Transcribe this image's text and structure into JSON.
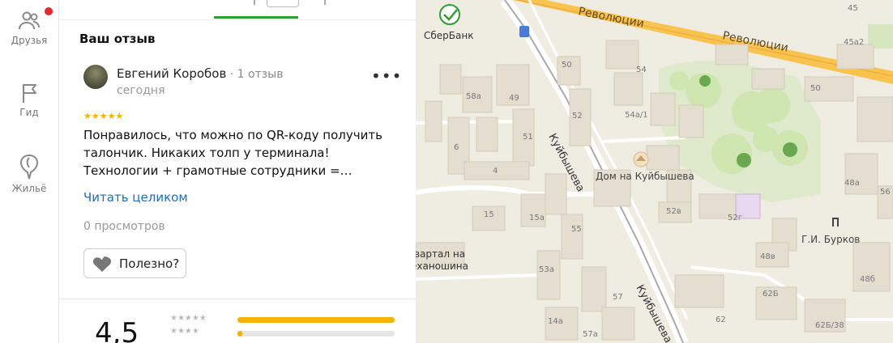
{
  "rail": {
    "friends_label": "Друзья",
    "guide_label": "Гид",
    "housing_label": "Жильё"
  },
  "review": {
    "section_title": "Ваш отзыв",
    "author": "Евгений Коробов",
    "author_count": "1 отзыв",
    "date": "сегодня",
    "stars": "★★★★★",
    "text": "Понравилось, что можно по QR-коду получить талончик. Никаких толп у терминала! Технологии + грамотные сотрудники =…",
    "read_more": "Читать целиком",
    "views": "0 просмотров",
    "useful_label": "Полезно?",
    "rating_value": "4,5",
    "distribution": [
      {
        "stars": "★★★★★",
        "fraction": 1.0
      },
      {
        "stars": "★★★★",
        "fraction": 0.03
      }
    ]
  },
  "map": {
    "poi_bank": "СберБанк",
    "poi_house": "Дом на Куйбышева",
    "poi_monument": "Г.И. Бурков",
    "street_revolution": "Революции",
    "street_kuybysheva": "Куйбышева",
    "quarter_label_1": "вартал на",
    "quarter_label_2": "еханошина",
    "buildings": [
      "45",
      "45а2",
      "50",
      "54",
      "50",
      "49",
      "58а",
      "52",
      "54а/1",
      "51",
      "6",
      "4",
      "48а",
      "15",
      "15а",
      "52в",
      "52г",
      "55",
      "48в",
      "48б",
      "53а",
      "62Б",
      "57",
      "62",
      "14а",
      "57а",
      "62Б/38",
      "56"
    ],
    "colors": {
      "road_major": "#f9c34d",
      "park": "#cfe6b0",
      "building": "#e4ded0",
      "accent_green": "#2e9e2e"
    }
  }
}
